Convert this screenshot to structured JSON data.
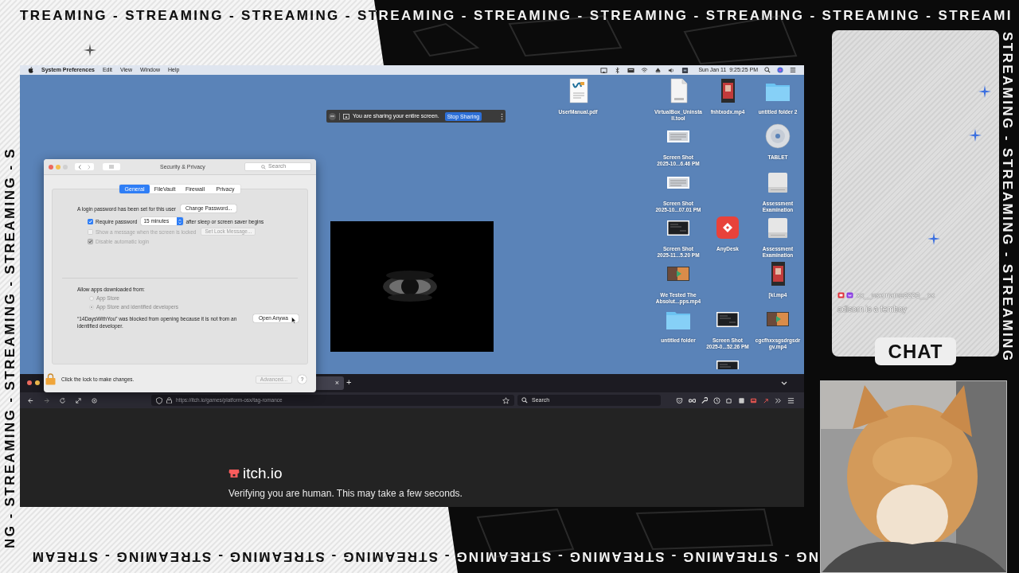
{
  "overlay": {
    "top_banner": "TREAMING - STREAMING - STREAMING - STREAMING - STREAMING - STREAMING - STREAMING - STREAMING - STREAMI",
    "bottom_banner": "NG - STREAMING - STREAMING - STREAMING - STREAMING - STREAMING - STREAMING - STREAM",
    "left_banner": "NG - STREAMING - STREAMING - STREAMING - S",
    "right_banner": "STREAMING - STREAMING - STREAMING"
  },
  "menu_bar": {
    "app_name": "System Preferences",
    "menus": [
      "Edit",
      "View",
      "Window",
      "Help"
    ],
    "clock": "Sun Jan 11  9:25:25 PM"
  },
  "sharing_bar": {
    "message": "You are sharing your entire screen.",
    "button": "Stop Sharing"
  },
  "security_window": {
    "title": "Security & Privacy",
    "search_placeholder": "Search",
    "tabs": [
      {
        "label": "General",
        "selected": true
      },
      {
        "label": "FileVault",
        "selected": false
      },
      {
        "label": "Firewall",
        "selected": false
      },
      {
        "label": "Privacy",
        "selected": false
      }
    ],
    "password_text": "A login password has been set for this user",
    "change_password_button": "Change Password...",
    "options": [
      {
        "label": "Require password",
        "checked": true,
        "disabled": false,
        "select": "15 minutes",
        "suffix": "after sleep or screen saver begins"
      },
      {
        "label": "Show a message when the screen is locked",
        "checked": false,
        "disabled": true,
        "button": "Set Lock Message..."
      },
      {
        "label": "Disable automatic login",
        "checked": true,
        "disabled": true
      }
    ],
    "allow_heading": "Allow apps downloaded from:",
    "radios": [
      {
        "label": "App Store",
        "selected": false,
        "disabled": true
      },
      {
        "label": "App Store and identified developers",
        "selected": true,
        "disabled": true
      }
    ],
    "blocked_text": "“14DaysWithYou” was blocked from opening because it is not from an identified developer.",
    "open_button": "Open Anywa",
    "lock_text": "Click the lock to make changes.",
    "advanced_button": "Advanced...",
    "help_button": "?"
  },
  "desktop_icons": [
    {
      "kind": "pdf",
      "label_lines": [
        "UserManual.pdf"
      ]
    },
    {
      "kind": "document",
      "label_lines": [
        "VirtualBox_Uninsta",
        "ll.tool"
      ]
    },
    {
      "kind": "tallvideo",
      "label_lines": [
        "fnhtxodx.mp4"
      ]
    },
    {
      "kind": "folder",
      "label_lines": [
        "untitled folder 2"
      ]
    },
    {
      "kind": "screenshot",
      "label_lines": [
        "Screen Shot",
        "2025-10...6.46 PM"
      ]
    },
    {
      "kind": "disc",
      "label_lines": [
        "TABLET"
      ]
    },
    {
      "kind": "screenshot",
      "label_lines": [
        "Screen Shot",
        "2025-10...07.01 PM"
      ]
    },
    {
      "kind": "drive",
      "label_lines": [
        "Assessment",
        "Examination"
      ]
    },
    {
      "kind": "darkshot",
      "label_lines": [
        "Screen Shot",
        "2025-11...5.20 PM"
      ]
    },
    {
      "kind": "app",
      "label_lines": [
        "AnyDesk"
      ]
    },
    {
      "kind": "drive",
      "label_lines": [
        "Assessment",
        "Examination"
      ]
    },
    {
      "kind": "widevideo",
      "label_lines": [
        "We Tested The",
        "Absolut...pps.mp4"
      ]
    },
    {
      "kind": "tallvideo",
      "label_lines": [
        "[kl.mp4"
      ]
    },
    {
      "kind": "folder",
      "label_lines": [
        "untitled folder"
      ]
    },
    {
      "kind": "darkshot",
      "label_lines": [
        "Screen Shot",
        "2025-0...52.26 PM"
      ]
    },
    {
      "kind": "widevideo",
      "label_lines": [
        "cgcfhxxsgsdrgsdr",
        "gv.mp4"
      ]
    },
    {
      "kind": "darkshot"
    }
  ],
  "browser": {
    "tab_close": "×",
    "new_tab": "+",
    "url": "https://itch.io/games/platform-osx/tag-romance",
    "search_placeholder": "Search",
    "site_name": "itch.io",
    "status_text": "Verifying you are human. This may take a few seconds."
  },
  "chat": {
    "messages": [
      {
        "user": "xx__username2223__xx",
        "text": "adisorn is a femboy"
      }
    ],
    "label": "CHAT"
  }
}
